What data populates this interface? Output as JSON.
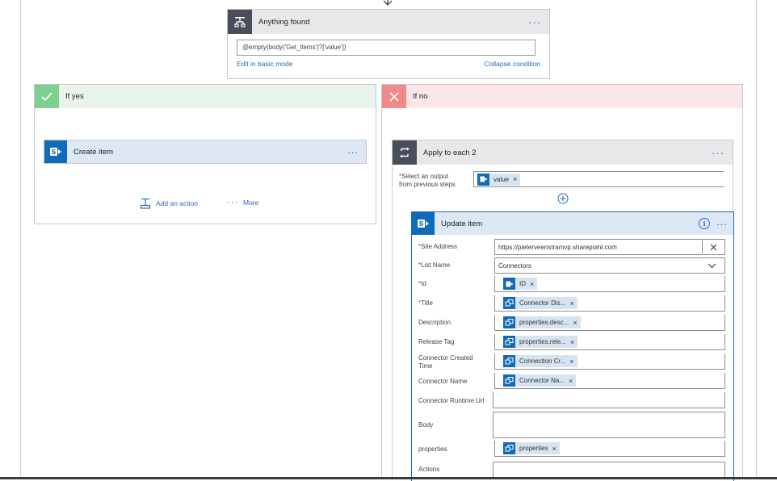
{
  "condition": {
    "title": "Anything found",
    "expression": "@empty(body('Get_items')?['value'])",
    "edit_link": "Edit in basic mode",
    "collapse_link": "Collapse condition",
    "more": "···"
  },
  "if_yes": {
    "title": "If yes",
    "create_item": {
      "title": "Create item",
      "more": "···"
    },
    "add_action": "Add an action",
    "more_label": "More",
    "more_dots": "···"
  },
  "if_no": {
    "title": "If no",
    "apply_each": {
      "title": "Apply to each 2",
      "more": "···",
      "select_label_1": "Select an output",
      "select_label_2": "from previous steps",
      "select_token": "value",
      "update_item": {
        "title": "Update item",
        "more": "···",
        "fields": {
          "site_address": {
            "label": "Site Address",
            "value": "https://pieterveenstramvp.sharepoint.com"
          },
          "list_name": {
            "label": "List Name",
            "value": "Connectors"
          },
          "id": {
            "label": "Id",
            "token": "ID"
          },
          "title": {
            "label": "Title",
            "token": "Connector Dis..."
          },
          "description": {
            "label": "Description",
            "token": "properties.desc..."
          },
          "release_tag": {
            "label": "Release Tag",
            "token": "properties.rele..."
          },
          "created_time": {
            "label_1": "Connector Created",
            "label_2": "Time",
            "token": "Connection Cr..."
          },
          "connector_name": {
            "label": "Connector Name",
            "token": "Connector Na..."
          },
          "runtime_url": {
            "label": "Connector Runtime Url"
          },
          "body": {
            "label": "Body"
          },
          "properties": {
            "label": "properties",
            "token": "properties"
          },
          "actions": {
            "label": "Actions"
          }
        }
      }
    }
  },
  "required_mark": "*",
  "token_close": "×",
  "icons": {
    "condition": "condition-icon",
    "check": "check-icon",
    "cross": "cross-icon",
    "sharepoint": "sharepoint-icon",
    "loop": "loop-icon",
    "info": "info-icon",
    "add": "plus-circle-icon",
    "clear": "clear-icon",
    "dropdown": "chevron-down-icon",
    "dynamic": "dynamic-content-icon"
  },
  "colors": {
    "accent": "#2a6ab8",
    "sharepoint": "#0f6ab9",
    "yes_bg": "#e9f4ec",
    "no_bg": "#fbe7e7",
    "header_gray": "#e8e8ea"
  }
}
